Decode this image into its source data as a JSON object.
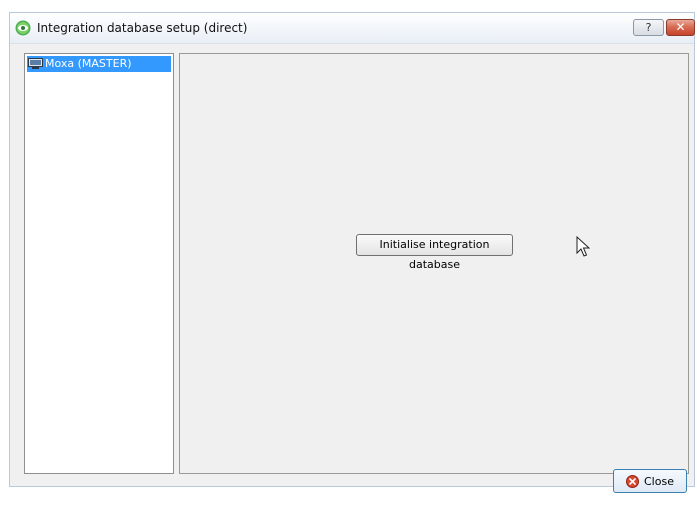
{
  "window": {
    "title": "Integration database setup (direct)",
    "help_glyph": "?",
    "close_glyph": "✕"
  },
  "tree": {
    "items": [
      {
        "label": "Moxa (MASTER)",
        "icon": "monitor-icon",
        "selected": true
      }
    ]
  },
  "content": {
    "init_button_label": "Initialise integration database"
  },
  "footer": {
    "close_label": "Close",
    "close_icon": "close-circle-icon"
  },
  "colors": {
    "selection": "#3399ff",
    "titlebar_close": "#c7442a",
    "window_bg": "#f0f0f0"
  }
}
